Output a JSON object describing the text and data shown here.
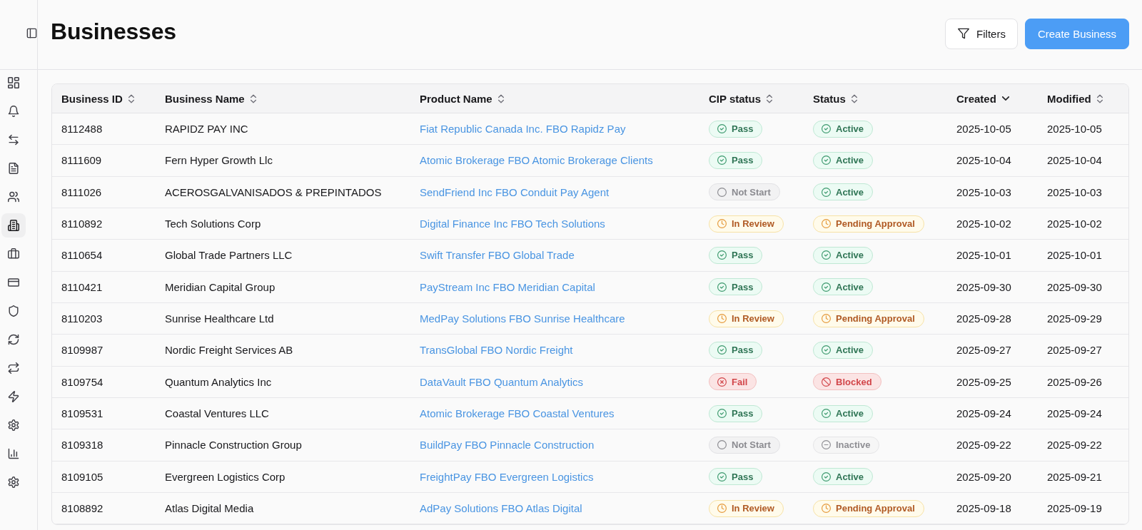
{
  "sidebar": {
    "items": [
      {
        "selected": false
      },
      {
        "selected": false
      },
      {
        "selected": false
      },
      {
        "selected": false
      },
      {
        "selected": false
      },
      {
        "selected": true
      },
      {
        "selected": false
      },
      {
        "selected": false
      },
      {
        "selected": false
      },
      {
        "selected": false
      },
      {
        "selected": false
      },
      {
        "selected": false
      },
      {
        "selected": false
      },
      {
        "selected": false
      },
      {
        "selected": false
      }
    ]
  },
  "header": {
    "title": "Businesses",
    "filters_button": {
      "label": "Filters"
    },
    "create_button": {
      "label": "Create Business"
    }
  },
  "table": {
    "columns": [
      {
        "label": "Business ID",
        "sorted": false
      },
      {
        "label": "Business Name",
        "sorted": false
      },
      {
        "label": "Product Name",
        "sorted": false
      },
      {
        "label": "CIP status",
        "sorted": false
      },
      {
        "label": "Status",
        "sorted": false
      },
      {
        "label": "Created",
        "sorted": true
      },
      {
        "label": "Modified",
        "sorted": false
      }
    ],
    "rows": [
      {
        "business_id": "8112488",
        "business_name": "RAPIDZ PAY INC",
        "product_name": "Fiat Republic Canada Inc. FBO Rapidz Pay",
        "cip_status": {
          "label": "Pass",
          "kind": "pass"
        },
        "status": {
          "label": "Active",
          "kind": "active"
        },
        "created": "2025-10-05",
        "modified": "2025-10-05"
      },
      {
        "business_id": "8111609",
        "business_name": "Fern Hyper Growth Llc",
        "product_name": "Atomic Brokerage FBO Atomic Brokerage Clients",
        "cip_status": {
          "label": "Pass",
          "kind": "pass"
        },
        "status": {
          "label": "Active",
          "kind": "active"
        },
        "created": "2025-10-04",
        "modified": "2025-10-04"
      },
      {
        "business_id": "8111026",
        "business_name": "ACEROSGALVANISADOS & PREPINTADOS",
        "product_name": "SendFriend Inc FBO Conduit Pay Agent",
        "cip_status": {
          "label": "Not Start",
          "kind": "not_start"
        },
        "status": {
          "label": "Active",
          "kind": "active"
        },
        "created": "2025-10-03",
        "modified": "2025-10-03"
      },
      {
        "business_id": "8110892",
        "business_name": "Tech Solutions Corp",
        "product_name": "Digital Finance Inc FBO Tech Solutions",
        "cip_status": {
          "label": "In Review",
          "kind": "in_review"
        },
        "status": {
          "label": "Pending Approval",
          "kind": "pending"
        },
        "created": "2025-10-02",
        "modified": "2025-10-02"
      },
      {
        "business_id": "8110654",
        "business_name": "Global Trade Partners LLC",
        "product_name": "Swift Transfer FBO Global Trade",
        "cip_status": {
          "label": "Pass",
          "kind": "pass"
        },
        "status": {
          "label": "Active",
          "kind": "active"
        },
        "created": "2025-10-01",
        "modified": "2025-10-01"
      },
      {
        "business_id": "8110421",
        "business_name": "Meridian Capital Group",
        "product_name": "PayStream Inc FBO Meridian Capital",
        "cip_status": {
          "label": "Pass",
          "kind": "pass"
        },
        "status": {
          "label": "Active",
          "kind": "active"
        },
        "created": "2025-09-30",
        "modified": "2025-09-30"
      },
      {
        "business_id": "8110203",
        "business_name": "Sunrise Healthcare Ltd",
        "product_name": "MedPay Solutions FBO Sunrise Healthcare",
        "cip_status": {
          "label": "In Review",
          "kind": "in_review"
        },
        "status": {
          "label": "Pending Approval",
          "kind": "pending"
        },
        "created": "2025-09-28",
        "modified": "2025-09-29"
      },
      {
        "business_id": "8109987",
        "business_name": "Nordic Freight Services AB",
        "product_name": "TransGlobal FBO Nordic Freight",
        "cip_status": {
          "label": "Pass",
          "kind": "pass"
        },
        "status": {
          "label": "Active",
          "kind": "active"
        },
        "created": "2025-09-27",
        "modified": "2025-09-27"
      },
      {
        "business_id": "8109754",
        "business_name": "Quantum Analytics Inc",
        "product_name": "DataVault FBO Quantum Analytics",
        "cip_status": {
          "label": "Fail",
          "kind": "fail"
        },
        "status": {
          "label": "Blocked",
          "kind": "blocked"
        },
        "created": "2025-09-25",
        "modified": "2025-09-26"
      },
      {
        "business_id": "8109531",
        "business_name": "Coastal Ventures LLC",
        "product_name": "Atomic Brokerage FBO Coastal Ventures",
        "cip_status": {
          "label": "Pass",
          "kind": "pass"
        },
        "status": {
          "label": "Active",
          "kind": "active"
        },
        "created": "2025-09-24",
        "modified": "2025-09-24"
      },
      {
        "business_id": "8109318",
        "business_name": "Pinnacle Construction Group",
        "product_name": "BuildPay FBO Pinnacle Construction",
        "cip_status": {
          "label": "Not Start",
          "kind": "not_start"
        },
        "status": {
          "label": "Inactive",
          "kind": "inactive"
        },
        "created": "2025-09-22",
        "modified": "2025-09-22"
      },
      {
        "business_id": "8109105",
        "business_name": "Evergreen Logistics Corp",
        "product_name": "FreightPay FBO Evergreen Logistics",
        "cip_status": {
          "label": "Pass",
          "kind": "pass"
        },
        "status": {
          "label": "Active",
          "kind": "active"
        },
        "created": "2025-09-20",
        "modified": "2025-09-21"
      },
      {
        "business_id": "8108892",
        "business_name": "Atlas Digital Media",
        "product_name": "AdPay Solutions FBO Atlas Digital",
        "cip_status": {
          "label": "In Review",
          "kind": "in_review"
        },
        "status": {
          "label": "Pending Approval",
          "kind": "pending"
        },
        "created": "2025-09-18",
        "modified": "2025-09-19"
      }
    ]
  }
}
